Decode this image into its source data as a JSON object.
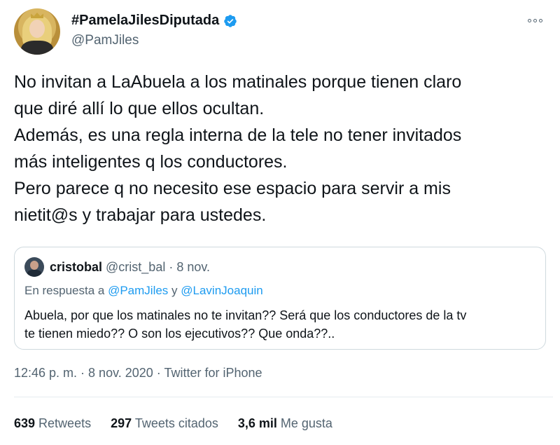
{
  "author": {
    "display_name": "#PamelaJilesDiputada",
    "handle": "@PamJiles",
    "verified": true
  },
  "tweet_lines": [
    "No invitan a LaAbuela a los matinales porque tienen claro",
    "que diré allí lo que ellos ocultan.",
    "Además, es una regla interna de la tele no tener invitados",
    "más inteligentes q los conductores.",
    "Pero parece q no necesito ese espacio para servir a mis",
    "nietit@s y trabajar para ustedes."
  ],
  "quoted": {
    "name": "cristobal",
    "meta": " @crist_bal · 8 nov.",
    "reply_prefix": "En respuesta a ",
    "reply_user1": "@PamJiles",
    "reply_and": " y ",
    "reply_user2": "@LavinJoaquin",
    "body_lines": [
      "Abuela, por que los matinales no te invitan?? Será que los conductores de la tv",
      "te tienen miedo?? O son los ejecutivos?? Que onda??.."
    ]
  },
  "timestamp": "12:46 p. m. · 8 nov. 2020 · Twitter for iPhone",
  "stats": {
    "retweets_num": "639",
    "retweets_label": " Retweets",
    "quotes_num": "297",
    "quotes_label": " Tweets citados",
    "likes_num": "3,6 mil",
    "likes_label": " Me gusta"
  },
  "colors": {
    "accent": "#1d9bf0",
    "secondary_text": "#536471",
    "border": "#cfd9de"
  },
  "icons": {
    "verified": "verified-badge-icon",
    "more": "more-options-icon"
  }
}
